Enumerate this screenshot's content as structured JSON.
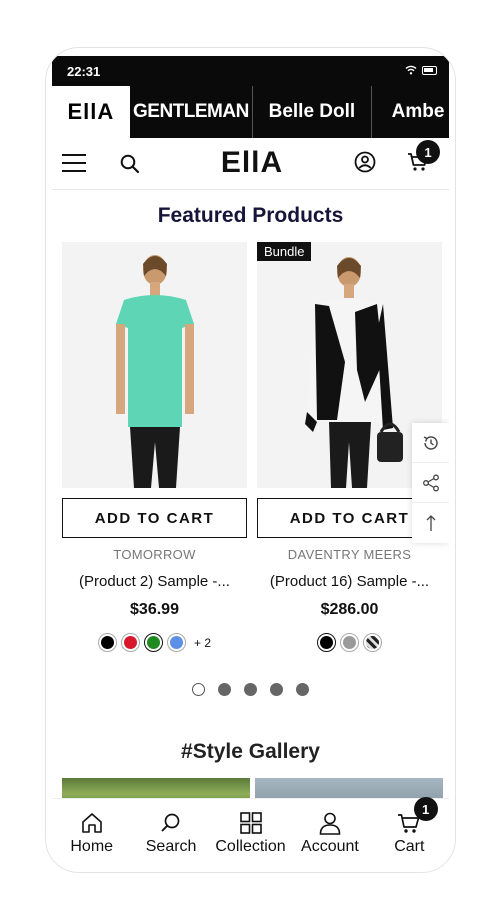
{
  "status_bar": {
    "time": "22:31"
  },
  "brands": [
    "EllA",
    "GENTLEMAN",
    "Belle Doll",
    "Ambe"
  ],
  "header": {
    "logo": "EllA",
    "cart_count": "1"
  },
  "featured": {
    "title": "Featured Products"
  },
  "products": [
    {
      "vendor": "TOMORROW",
      "name": "(Product 2) Sample -...",
      "price": "$36.99",
      "button": "ADD TO CART",
      "tag": "",
      "swatches": [
        "#000000",
        "#d6172c",
        "#1f8a1f",
        "#5c8fe6"
      ],
      "more_colors": "+ 2"
    },
    {
      "vendor": "DAVENTRY MEERS",
      "name": "(Product 16) Sample -...",
      "price": "$286.00",
      "button": "ADD TO CART",
      "tag": "Bundle",
      "swatches": [
        "#000000",
        "#9a9a9a",
        "pattern"
      ],
      "more_colors": ""
    }
  ],
  "carousel": {
    "pages": 5,
    "active": 0
  },
  "gallery": {
    "title": "#Style Gallery"
  },
  "bottom_nav": [
    {
      "label": "Home",
      "icon": "home-icon"
    },
    {
      "label": "Search",
      "icon": "search-icon"
    },
    {
      "label": "Collection",
      "icon": "grid-icon"
    },
    {
      "label": "Account",
      "icon": "user-icon"
    },
    {
      "label": "Cart",
      "icon": "cart-icon",
      "badge": "1"
    }
  ],
  "floating_actions": [
    "history-icon",
    "share-icon",
    "back-to-top-icon"
  ]
}
